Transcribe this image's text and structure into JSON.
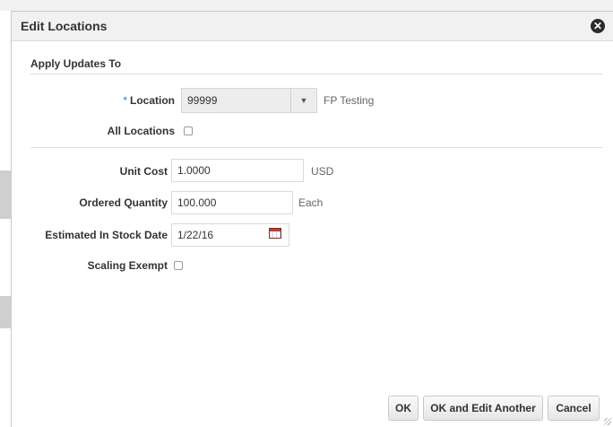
{
  "dialog": {
    "title": "Edit Locations",
    "close_icon": "close-icon"
  },
  "section": {
    "title": "Apply Updates To"
  },
  "location": {
    "required_mark": "*",
    "label": "Location",
    "value": "99999",
    "description": "FP Testing",
    "dropdown_icon": "chevron-down-icon",
    "dropdown_glyph": "▼"
  },
  "all_locations": {
    "label": "All Locations",
    "checked": false
  },
  "unit_cost": {
    "label": "Unit Cost",
    "value": "1.0000",
    "currency": "USD"
  },
  "ordered_quantity": {
    "label": "Ordered Quantity",
    "value": "100.000",
    "uom": "Each"
  },
  "estimated_in_stock_date": {
    "label": "Estimated In Stock Date",
    "value": "1/22/16",
    "calendar_icon": "calendar-icon"
  },
  "scaling_exempt": {
    "label": "Scaling Exempt",
    "checked": false
  },
  "buttons": {
    "ok": "OK",
    "ok_and_edit_another": "OK and Edit Another",
    "cancel": "Cancel"
  },
  "colors": {
    "required_mark": "#2f72b5",
    "header_bg": "#f1f1f1",
    "select_bg": "#ededed"
  }
}
